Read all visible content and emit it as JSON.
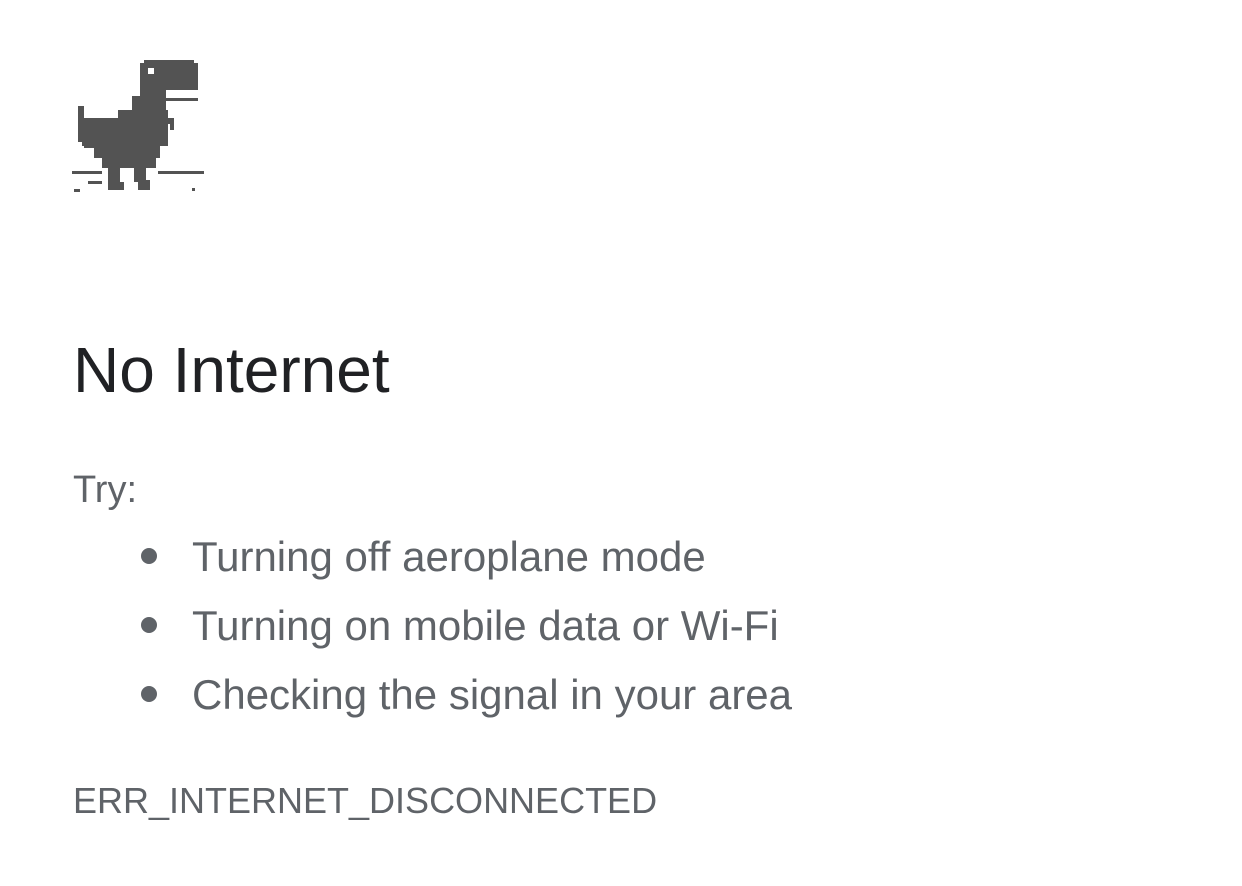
{
  "page": {
    "icon": "offline-dino-icon",
    "title": "No Internet",
    "try_label": "Try:",
    "suggestions": [
      "Turning off aeroplane mode",
      "Turning on mobile data or Wi-Fi",
      "Checking the signal in your area"
    ],
    "error_code": "ERR_INTERNET_DISCONNECTED"
  },
  "colors": {
    "title": "#202124",
    "body_text": "#5f6368",
    "dino": "#535353",
    "background": "#ffffff"
  }
}
